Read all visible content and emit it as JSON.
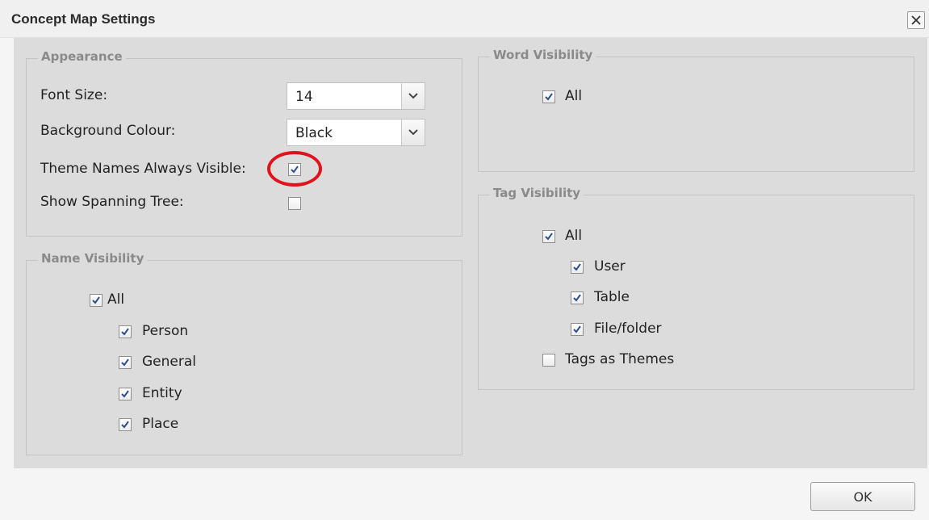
{
  "window": {
    "title": "Concept Map Settings",
    "ok_label": "OK"
  },
  "appearance": {
    "legend": "Appearance",
    "font_size_label": "Font Size:",
    "font_size_value": "14",
    "bg_label": "Background Colour:",
    "bg_value": "Black",
    "theme_names_label": "Theme Names Always Visible:",
    "theme_names_checked": true,
    "spanning_tree_label": "Show Spanning Tree:",
    "spanning_tree_checked": false
  },
  "name_visibility": {
    "legend": "Name Visibility",
    "all_label": "All",
    "items": [
      {
        "label": "Person",
        "checked": true
      },
      {
        "label": "General",
        "checked": true
      },
      {
        "label": "Entity",
        "checked": true
      },
      {
        "label": "Place",
        "checked": true
      }
    ]
  },
  "word_visibility": {
    "legend": "Word Visibility",
    "all_label": "All"
  },
  "tag_visibility": {
    "legend": "Tag Visibility",
    "all_label": "All",
    "items": [
      {
        "label": "User",
        "checked": true
      },
      {
        "label": "Table",
        "checked": true
      },
      {
        "label": "File/folder",
        "checked": true
      }
    ],
    "tags_as_themes_label": "Tags as Themes",
    "tags_as_themes_checked": false
  },
  "colors": {
    "highlight": "#e0121c",
    "panel_bg": "#dcdcdc",
    "check": "#2d4f8a"
  }
}
